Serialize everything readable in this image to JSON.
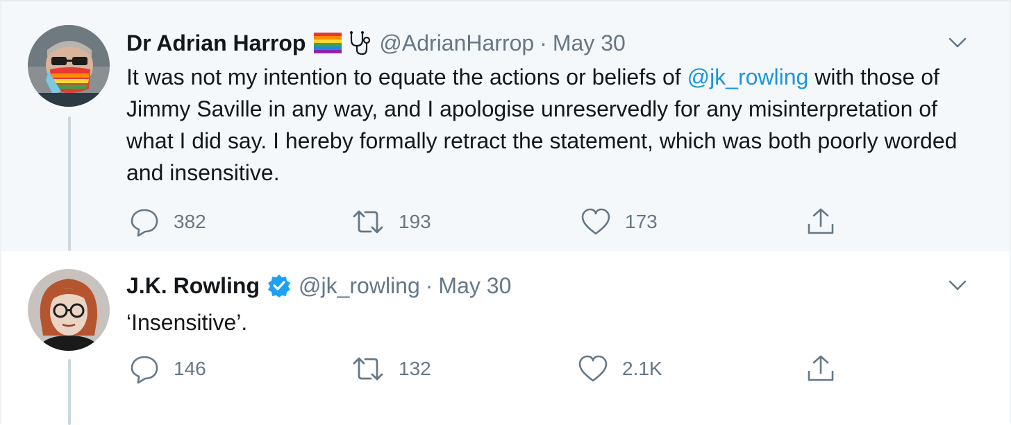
{
  "colors": {
    "link": "#1b95e0",
    "secondary_text": "#657786",
    "thread_line": "#ccd6dd",
    "verified": "#1da1f2",
    "highlight_bg": "#f5f8fa"
  },
  "tweets": [
    {
      "author_name": "Dr Adrian Harrop",
      "name_emojis": [
        "rainbow-flag-icon",
        "stethoscope-icon"
      ],
      "handle": "@AdrianHarrop",
      "separator": "·",
      "date": "May 30",
      "text_part1": "It was not my intention to equate the actions or beliefs of ",
      "mention": "@jk_rowling",
      "text_part2": " with those of Jimmy Saville in any way, and I apologise unreservedly for any misinterpretation of what I did say. I hereby formally retract the statement, which was both poorly worded and insensitive.",
      "replies": "382",
      "retweets": "193",
      "likes": "173"
    },
    {
      "author_name": "J.K. Rowling",
      "verified": true,
      "handle": "@jk_rowling",
      "separator": "·",
      "date": "May 30",
      "text": "‘Insensitive’.",
      "replies": "146",
      "retweets": "132",
      "likes": "2.1K"
    }
  ]
}
